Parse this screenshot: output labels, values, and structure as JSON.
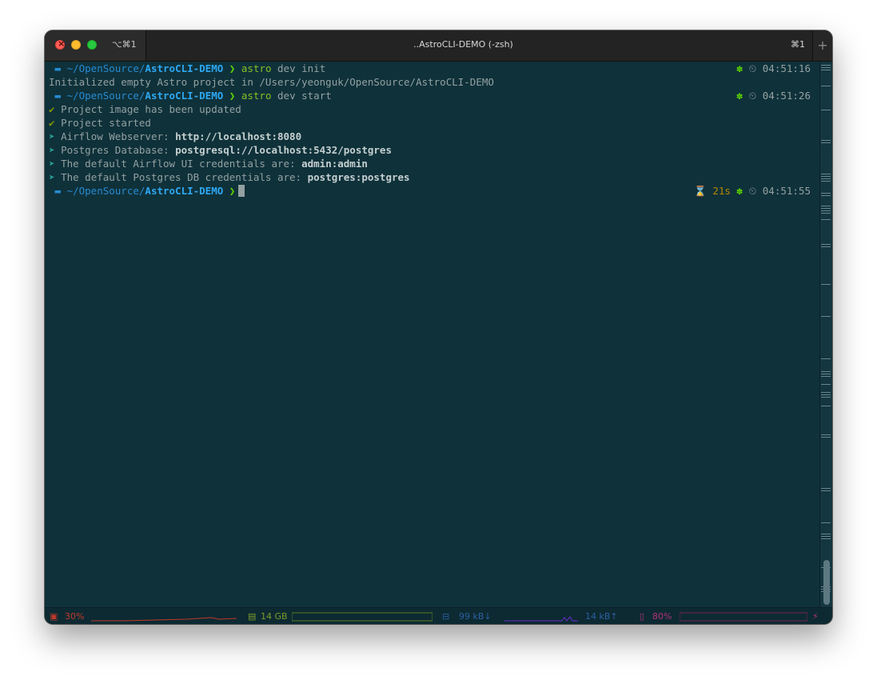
{
  "window": {
    "title": "..AstroCLI-DEMO (-zsh)",
    "tab_shortcut_left": "⌥⌘1",
    "tab_shortcut_right": "⌘1",
    "new_tab_label": "+"
  },
  "prompt": {
    "apple_icon": "",
    "folder_icon": "🗁",
    "path_prefix": "~/OpenSource/",
    "path_dir": "AstroCLI-DEMO",
    "chevron": "❯"
  },
  "lines": [
    {
      "type": "prompt",
      "command": "astro",
      "args": " dev init",
      "gear": "✽",
      "clock": "⏲",
      "time": "04:51:16"
    },
    {
      "type": "output",
      "text": "Initialized empty Astro project in /Users/yeonguk/OpenSource/AstroCLI-DEMO"
    },
    {
      "type": "prompt",
      "command": "astro",
      "args": " dev start",
      "gear": "✽",
      "clock": "⏲",
      "time": "04:51:26"
    },
    {
      "type": "check",
      "icon": "✔",
      "text": "Project image has been updated"
    },
    {
      "type": "check",
      "icon": "✔",
      "text": "Project started"
    },
    {
      "type": "info",
      "icon": "➤",
      "label": "Airflow Webserver: ",
      "value": "http://localhost:8080"
    },
    {
      "type": "info",
      "icon": "➤",
      "label": "Postgres Database: ",
      "value": "postgresql://localhost:5432/postgres"
    },
    {
      "type": "info",
      "icon": "➤",
      "label": "The default Airflow UI credentials are: ",
      "value": "admin:admin"
    },
    {
      "type": "info",
      "icon": "➤",
      "label": "The default Postgres DB credentials are: ",
      "value": "postgres:postgres"
    },
    {
      "type": "prompt-current",
      "hourglass": "⌛",
      "duration": "21s",
      "gear": "✽",
      "clock": "⏲",
      "time": "04:51:55"
    }
  ],
  "statusbar": {
    "cpu_icon": "cpu-icon",
    "cpu": "30%",
    "mem_icon": "memory-icon",
    "mem": "14 GB",
    "net_icon": "network-icon",
    "net_down": "99 kB↓",
    "net_up": "14 kB↑",
    "battery_icon": "battery-icon",
    "battery": "80%",
    "charging_icon": "⚡",
    "colors": {
      "cpu": "#c0392b",
      "mem": "#7a9a2a",
      "net": "#2b5fa0",
      "battery": "#b0307a"
    }
  }
}
